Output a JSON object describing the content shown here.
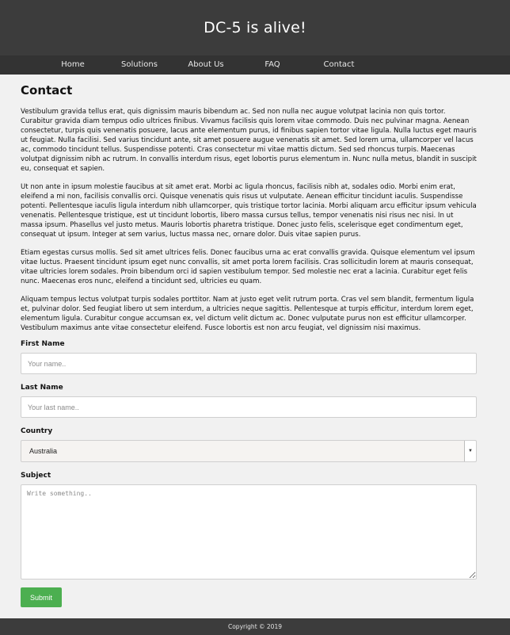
{
  "header": {
    "title": "DC-5 is alive!"
  },
  "nav": {
    "items": [
      {
        "label": "Home"
      },
      {
        "label": "Solutions"
      },
      {
        "label": "About Us"
      },
      {
        "label": "FAQ"
      },
      {
        "label": "Contact"
      }
    ]
  },
  "page": {
    "title": "Contact",
    "paragraphs": [
      "Vestibulum gravida tellus erat, quis dignissim mauris bibendum ac. Sed non nulla nec augue volutpat lacinia non quis tortor. Curabitur gravida diam tempus odio ultrices finibus. Vivamus facilisis quis lorem vitae commodo. Duis nec pulvinar magna. Aenean consectetur, turpis quis venenatis posuere, lacus ante elementum purus, id finibus sapien tortor vitae ligula. Nulla luctus eget mauris ut feugiat. Nulla facilisi. Sed varius tincidunt ante, sit amet posuere augue venenatis sit amet. Sed lorem urna, ullamcorper vel lacus ac, commodo tincidunt tellus. Suspendisse potenti. Cras consectetur mi vitae mattis dictum. Sed sed rhoncus turpis. Maecenas volutpat dignissim nibh ac rutrum. In convallis interdum risus, eget lobortis purus elementum in. Nunc nulla metus, blandit in suscipit eu, consequat et sapien.",
      "Ut non ante in ipsum molestie faucibus at sit amet erat. Morbi ac ligula rhoncus, facilisis nibh at, sodales odio. Morbi enim erat, eleifend a mi non, facilisis convallis orci. Quisque venenatis quis risus ut vulputate. Aenean efficitur tincidunt iaculis. Suspendisse potenti. Pellentesque iaculis ligula interdum nibh ullamcorper, quis tristique tortor lacinia. Morbi aliquam arcu efficitur ipsum vehicula venenatis. Pellentesque tristique, est ut tincidunt lobortis, libero massa cursus tellus, tempor venenatis nisi risus nec nisi. In ut massa ipsum. Phasellus vel justo metus. Mauris lobortis pharetra tristique. Donec justo felis, scelerisque eget condimentum eget, consequat ut ipsum. Integer at sem varius, luctus massa nec, ornare dolor. Duis vitae sapien purus.",
      "Etiam egestas cursus mollis. Sed sit amet ultrices felis. Donec faucibus urna ac erat convallis gravida. Quisque elementum vel ipsum vitae luctus. Praesent tincidunt ipsum eget nunc convallis, sit amet porta lorem facilisis. Cras sollicitudin lorem at mauris consequat, vitae ultricies lorem sodales. Proin bibendum orci id sapien vestibulum tempor. Sed molestie nec erat a lacinia. Curabitur eget felis nunc. Maecenas eros nunc, eleifend a tincidunt sed, ultricies eu quam.",
      "Aliquam tempus lectus volutpat turpis sodales porttitor. Nam at justo eget velit rutrum porta. Cras vel sem blandit, fermentum ligula et, pulvinar dolor. Sed feugiat libero ut sem interdum, a ultricies neque sagittis. Pellentesque at turpis efficitur, interdum lorem eget, elementum ligula. Curabitur congue accumsan ex, vel dictum velit dictum ac. Donec vulputate purus non est efficitur ullamcorper. Vestibulum maximus ante vitae consectetur eleifend. Fusce lobortis est non arcu feugiat, vel dignissim nisi maximus."
    ]
  },
  "form": {
    "first_name": {
      "label": "First Name",
      "placeholder": "Your name..",
      "value": ""
    },
    "last_name": {
      "label": "Last Name",
      "placeholder": "Your last name..",
      "value": ""
    },
    "country": {
      "label": "Country",
      "selected": "Australia"
    },
    "subject": {
      "label": "Subject",
      "placeholder": "Write something..",
      "value": ""
    },
    "submit_label": "Submit"
  },
  "footer": {
    "text": "Copyright © 2019"
  },
  "colors": {
    "header_bg": "#3c3c3c",
    "nav_bg": "#333333",
    "main_bg": "#f1f1f1",
    "submit_bg": "#4caf50"
  },
  "icons": {
    "select_arrow": "chevron-down-icon",
    "textarea_resize": "resize-handle-icon"
  }
}
